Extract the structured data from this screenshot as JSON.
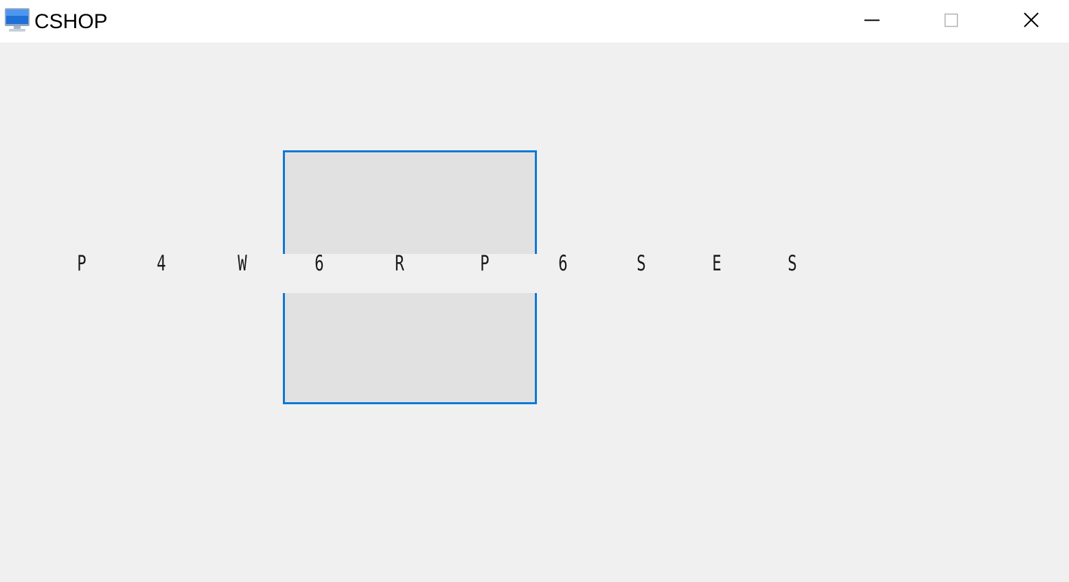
{
  "window": {
    "title": "CSHOP",
    "app_icon": "monitor-icon",
    "controls": {
      "minimize_icon": "minimize-icon",
      "maximize_icon": "maximize-icon",
      "close_icon": "close-icon"
    }
  },
  "sequence": {
    "characters": [
      "P",
      "4",
      "W",
      "6",
      "R",
      "P",
      "6",
      "S",
      "E",
      "S"
    ],
    "highlight_color": "#0b78d7"
  }
}
